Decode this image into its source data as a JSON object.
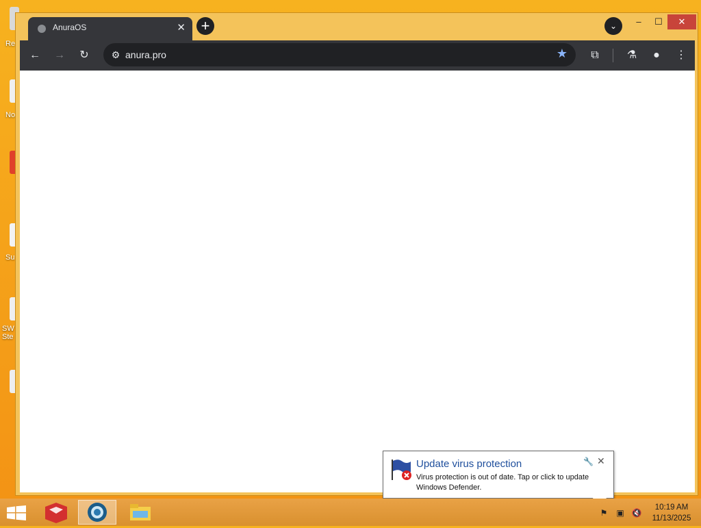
{
  "desktop": {
    "icons": [
      {
        "label": "Re"
      },
      {
        "label": "No"
      },
      {
        "label": ""
      },
      {
        "label": "Su"
      },
      {
        "label": "SW Ste"
      },
      {
        "label": ""
      }
    ]
  },
  "browser": {
    "tab": {
      "title": "AnuraOS",
      "close": "✕"
    },
    "new_tab": "+",
    "tab_search": "⌄",
    "window_controls": {
      "minimize": "–",
      "maximize": "☐",
      "close": "✕"
    },
    "toolbar": {
      "back": "←",
      "forward": "→",
      "reload": "↻",
      "site_info": "⚙",
      "url": "anura.pro",
      "bookmark": "★",
      "extensions": "⧉",
      "labs": "⚗",
      "profile": "●",
      "menu": "⋮"
    }
  },
  "notification": {
    "title": "Update virus protection",
    "message": "Virus protection is out of date. Tap or click to update Windows Defender.",
    "settings": "🔧",
    "close": "✕"
  },
  "taskbar": {
    "tray": {
      "flag": "⚑",
      "network": "▣",
      "volume": "🔇"
    },
    "clock": {
      "time": "10:19 AM",
      "date": "11/13/2025"
    }
  },
  "colors": {
    "accent": "#8ab4f8",
    "toolbar": "#35363a",
    "notif_title": "#1e4e9c",
    "close_red": "#c8443a"
  }
}
